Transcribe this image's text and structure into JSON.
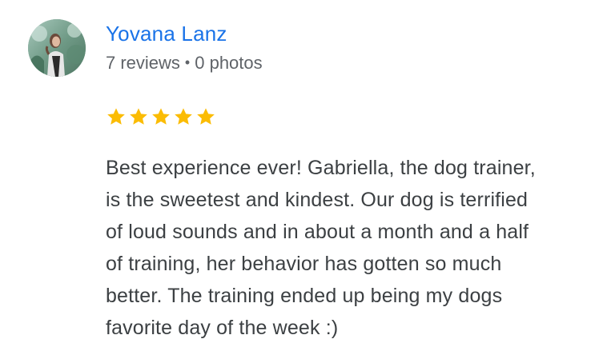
{
  "reviewer": {
    "name": "Yovana Lanz",
    "reviews_count": "7 reviews",
    "separator": "•",
    "photos_count": "0 photos",
    "avatar_icon": "profile-photo"
  },
  "rating": {
    "stars": 5,
    "max": 5,
    "star_color": "#fbbc04"
  },
  "review": {
    "lines": [
      "Best experience ever! Gabriella, the dog trainer,",
      "is the sweetest and kindest. Our dog is terrified",
      "of loud sounds and in about a month and a half",
      "of training, her behavior has gotten so much",
      "better. The training ended up being my dogs",
      "favorite day of the week :)"
    ]
  },
  "colors": {
    "name": "#1a73e8",
    "meta": "#5f6368",
    "text": "#3c4043"
  }
}
